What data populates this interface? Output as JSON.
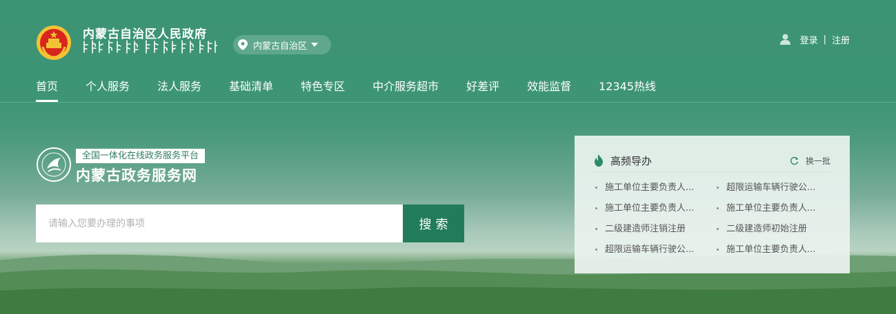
{
  "header": {
    "gov_title": "内蒙古自治区人民政府",
    "location": "内蒙古自治区",
    "auth": {
      "login": "登录",
      "separator": "|",
      "register": "注册"
    }
  },
  "nav": {
    "items": [
      {
        "label": "首页",
        "active": true
      },
      {
        "label": "个人服务"
      },
      {
        "label": "法人服务"
      },
      {
        "label": "基础清单"
      },
      {
        "label": "特色专区"
      },
      {
        "label": "中介服务超市"
      },
      {
        "label": "好差评"
      },
      {
        "label": "效能监督"
      },
      {
        "label": "12345热线"
      }
    ]
  },
  "platform": {
    "tag": "全国一体化在线政务服务平台",
    "name": "内蒙古政务服务网"
  },
  "search": {
    "placeholder": "请输入您要办理的事项",
    "button": "搜索"
  },
  "hot_guide": {
    "title": "高频导办",
    "refresh": "换一批",
    "items": [
      "施工单位主要负责人...",
      "超限运输车辆行驶公...",
      "施工单位主要负责人...",
      "施工单位主要负责人...",
      "二级建造师注销注册",
      "二级建造师初始注册",
      "超限运输车辆行驶公...",
      "施工单位主要负责人..."
    ]
  },
  "colors": {
    "header_green": "#3b9474",
    "search_button": "#227c5a",
    "emblem_red": "#d7261e",
    "emblem_gold": "#f3c234"
  }
}
